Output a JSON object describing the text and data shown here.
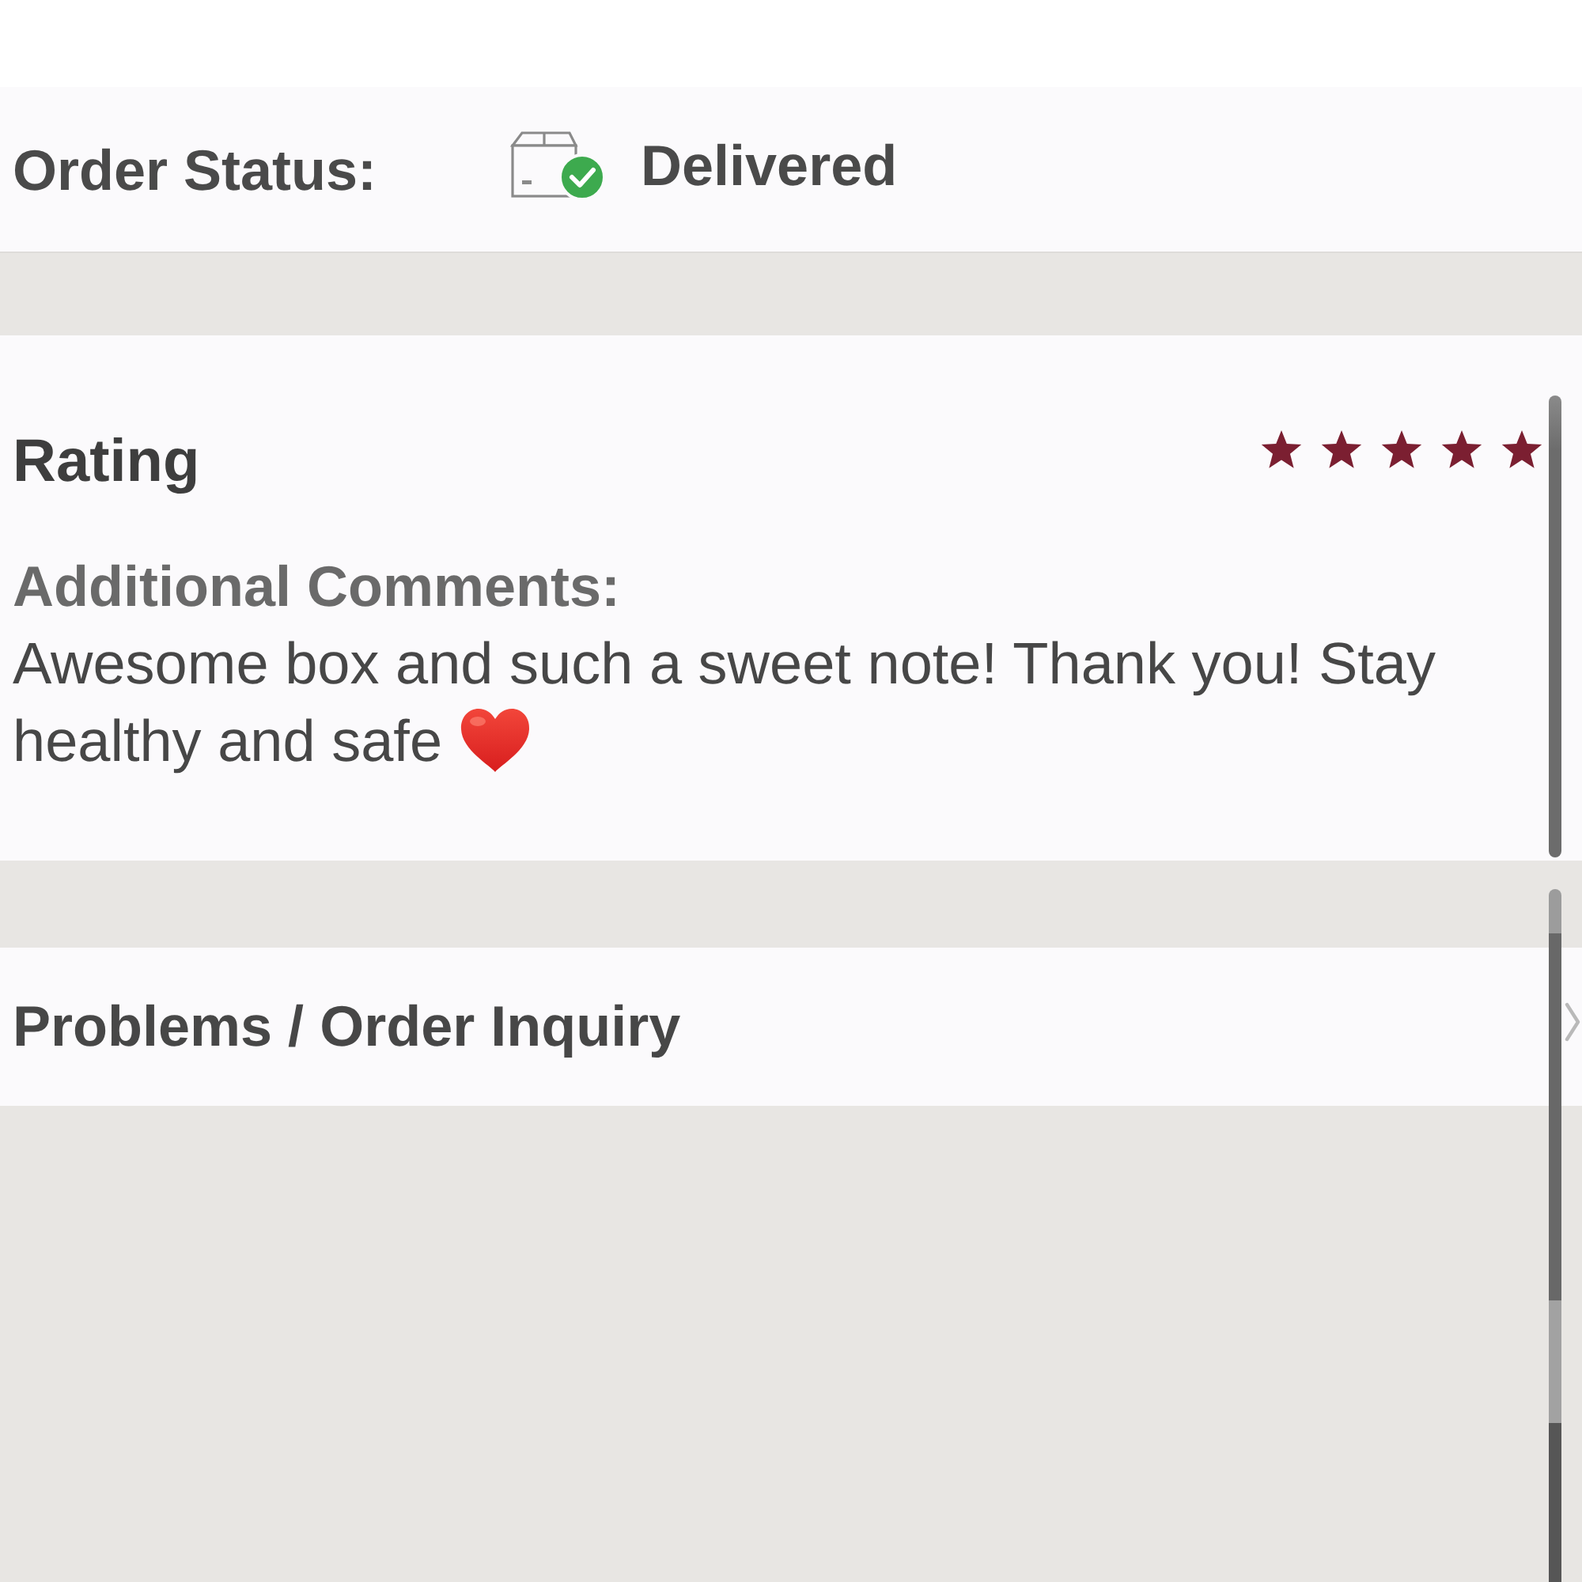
{
  "order_status": {
    "label": "Order Status:",
    "value": "Delivered"
  },
  "rating": {
    "label": "Rating",
    "stars": 5,
    "comments_label": "Additional Comments:",
    "comment": "Awesome box and such a sweet note! Thank you! Stay healthy and safe"
  },
  "links": [
    {
      "label": "Problems / Order Inquiry"
    }
  ]
}
